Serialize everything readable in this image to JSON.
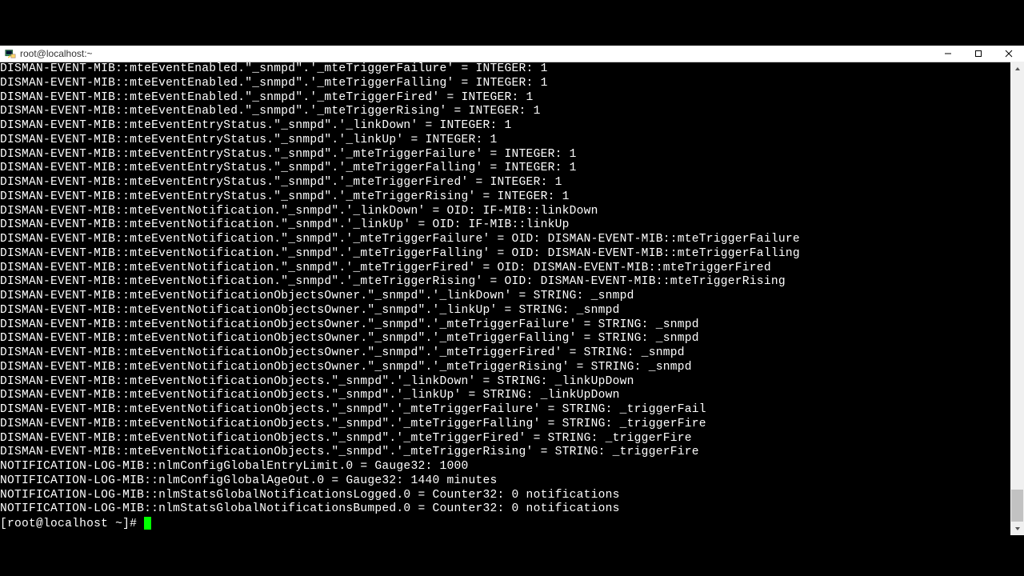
{
  "window": {
    "title": "root@localhost:~"
  },
  "terminal": {
    "lines": [
      "DISMAN-EVENT-MIB::mteEventEnabled.\"_snmpd\".'_mteTriggerFailure' = INTEGER: 1",
      "DISMAN-EVENT-MIB::mteEventEnabled.\"_snmpd\".'_mteTriggerFalling' = INTEGER: 1",
      "DISMAN-EVENT-MIB::mteEventEnabled.\"_snmpd\".'_mteTriggerFired' = INTEGER: 1",
      "DISMAN-EVENT-MIB::mteEventEnabled.\"_snmpd\".'_mteTriggerRising' = INTEGER: 1",
      "DISMAN-EVENT-MIB::mteEventEntryStatus.\"_snmpd\".'_linkDown' = INTEGER: 1",
      "DISMAN-EVENT-MIB::mteEventEntryStatus.\"_snmpd\".'_linkUp' = INTEGER: 1",
      "DISMAN-EVENT-MIB::mteEventEntryStatus.\"_snmpd\".'_mteTriggerFailure' = INTEGER: 1",
      "DISMAN-EVENT-MIB::mteEventEntryStatus.\"_snmpd\".'_mteTriggerFalling' = INTEGER: 1",
      "DISMAN-EVENT-MIB::mteEventEntryStatus.\"_snmpd\".'_mteTriggerFired' = INTEGER: 1",
      "DISMAN-EVENT-MIB::mteEventEntryStatus.\"_snmpd\".'_mteTriggerRising' = INTEGER: 1",
      "DISMAN-EVENT-MIB::mteEventNotification.\"_snmpd\".'_linkDown' = OID: IF-MIB::linkDown",
      "DISMAN-EVENT-MIB::mteEventNotification.\"_snmpd\".'_linkUp' = OID: IF-MIB::linkUp",
      "DISMAN-EVENT-MIB::mteEventNotification.\"_snmpd\".'_mteTriggerFailure' = OID: DISMAN-EVENT-MIB::mteTriggerFailure",
      "DISMAN-EVENT-MIB::mteEventNotification.\"_snmpd\".'_mteTriggerFalling' = OID: DISMAN-EVENT-MIB::mteTriggerFalling",
      "DISMAN-EVENT-MIB::mteEventNotification.\"_snmpd\".'_mteTriggerFired' = OID: DISMAN-EVENT-MIB::mteTriggerFired",
      "DISMAN-EVENT-MIB::mteEventNotification.\"_snmpd\".'_mteTriggerRising' = OID: DISMAN-EVENT-MIB::mteTriggerRising",
      "DISMAN-EVENT-MIB::mteEventNotificationObjectsOwner.\"_snmpd\".'_linkDown' = STRING: _snmpd",
      "DISMAN-EVENT-MIB::mteEventNotificationObjectsOwner.\"_snmpd\".'_linkUp' = STRING: _snmpd",
      "DISMAN-EVENT-MIB::mteEventNotificationObjectsOwner.\"_snmpd\".'_mteTriggerFailure' = STRING: _snmpd",
      "DISMAN-EVENT-MIB::mteEventNotificationObjectsOwner.\"_snmpd\".'_mteTriggerFalling' = STRING: _snmpd",
      "DISMAN-EVENT-MIB::mteEventNotificationObjectsOwner.\"_snmpd\".'_mteTriggerFired' = STRING: _snmpd",
      "DISMAN-EVENT-MIB::mteEventNotificationObjectsOwner.\"_snmpd\".'_mteTriggerRising' = STRING: _snmpd",
      "DISMAN-EVENT-MIB::mteEventNotificationObjects.\"_snmpd\".'_linkDown' = STRING: _linkUpDown",
      "DISMAN-EVENT-MIB::mteEventNotificationObjects.\"_snmpd\".'_linkUp' = STRING: _linkUpDown",
      "DISMAN-EVENT-MIB::mteEventNotificationObjects.\"_snmpd\".'_mteTriggerFailure' = STRING: _triggerFail",
      "DISMAN-EVENT-MIB::mteEventNotificationObjects.\"_snmpd\".'_mteTriggerFalling' = STRING: _triggerFire",
      "DISMAN-EVENT-MIB::mteEventNotificationObjects.\"_snmpd\".'_mteTriggerFired' = STRING: _triggerFire",
      "DISMAN-EVENT-MIB::mteEventNotificationObjects.\"_snmpd\".'_mteTriggerRising' = STRING: _triggerFire",
      "NOTIFICATION-LOG-MIB::nlmConfigGlobalEntryLimit.0 = Gauge32: 1000",
      "NOTIFICATION-LOG-MIB::nlmConfigGlobalAgeOut.0 = Gauge32: 1440 minutes",
      "NOTIFICATION-LOG-MIB::nlmStatsGlobalNotificationsLogged.0 = Counter32: 0 notifications",
      "NOTIFICATION-LOG-MIB::nlmStatsGlobalNotificationsBumped.0 = Counter32: 0 notifications"
    ],
    "prompt": "[root@localhost ~]# "
  }
}
